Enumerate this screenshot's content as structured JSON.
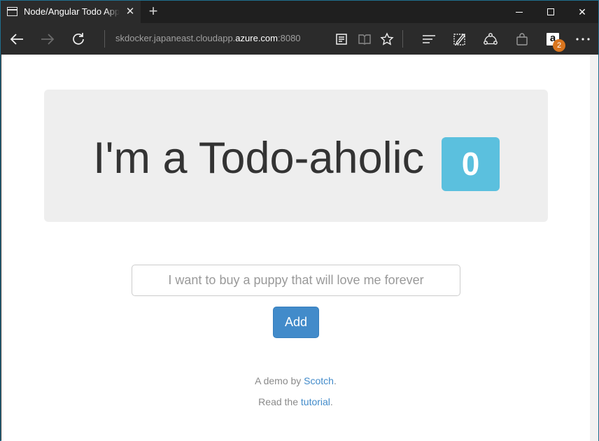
{
  "browser": {
    "tab_title": "Node/Angular Todo App",
    "tab_close": "✕",
    "new_tab": "+",
    "url_prefix": "skdocker.japaneast.cloudapp.",
    "url_domain": "azure.com",
    "url_suffix": ":8080",
    "amazon_badge_count": "2",
    "window_controls": {
      "minimize": "minimize-icon",
      "maximize": "maximize-icon",
      "close": "✕"
    },
    "nav_icons": [
      "back-arrow-icon",
      "forward-arrow-icon",
      "refresh-icon"
    ],
    "toolbar_icons": [
      "reading-view-icon",
      "reading-list-icon",
      "favorite-star-icon",
      "hub-icon",
      "web-note-icon",
      "share-icon",
      "shopping-bag-icon",
      "amazon-extension-icon",
      "more-icon"
    ]
  },
  "page": {
    "title": "I'm a Todo-aholic",
    "todo_count": "0",
    "input_placeholder": "I want to buy a puppy that will love me forever",
    "add_button": "Add",
    "footer": {
      "demo_prefix": "A demo by ",
      "demo_link": "Scotch",
      "demo_suffix": ".",
      "read_prefix": "Read the ",
      "read_link": "tutorial",
      "read_suffix": "."
    }
  },
  "colors": {
    "browser_chrome": "#2b2b2b",
    "jumbotron_bg": "#eeeeee",
    "count_label": "#5bc0de",
    "primary_button": "#428bca",
    "link": "#428bca",
    "amazon_badge": "#d9751e"
  }
}
